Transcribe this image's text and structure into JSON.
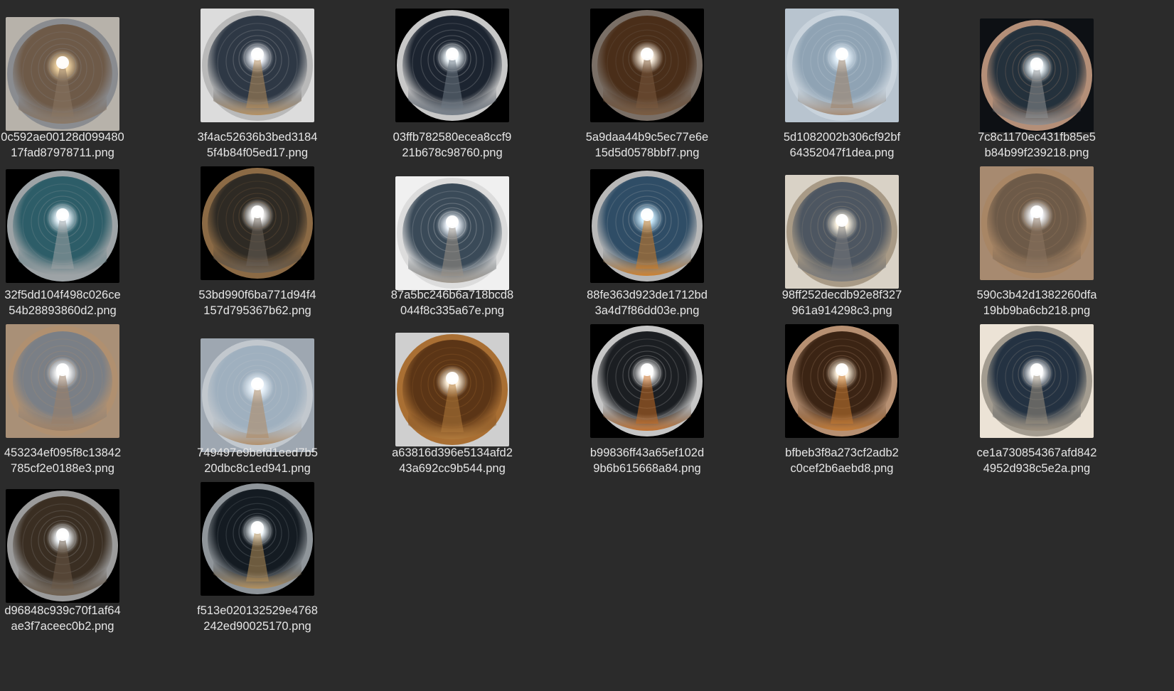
{
  "files": [
    {
      "line1": "0c592ae00128d099480",
      "line2": "17fad87978711.png",
      "rim": "#8a8c90",
      "wall": "#6e5a48",
      "glow": "#f3d6a4",
      "bg": "#b7b2aa",
      "bottom": "#8b7763"
    },
    {
      "line1": "3f4ac52636b3bed3184",
      "line2": "5f4b84f05ed17.png",
      "rim": "#b9b9b9",
      "wall": "#2e3845",
      "glow": "#f6f9ff",
      "bg": "#dcdcdc",
      "bottom": "#b58d5a"
    },
    {
      "line1": "03ffb782580ecea8ccf9",
      "line2": "21b678c98760.png",
      "rim": "#c8c8c8",
      "wall": "#1c2430",
      "glow": "#f3fbff",
      "bg": "#000000",
      "bottom": "#6e7883"
    },
    {
      "line1": "5a9daa44b9c5ec77e6e",
      "line2": "15d5d0578bbf7.png",
      "rim": "#7a6f66",
      "wall": "#4a2e19",
      "glow": "#fff5e6",
      "bg": "#000000",
      "bottom": "#7a5a3e"
    },
    {
      "line1": "5d1082002b306cf92bf",
      "line2": "64352047f1dea.png",
      "rim": "#c9d3dc",
      "wall": "#8fa3b4",
      "glow": "#eaf6ff",
      "bg": "#b8c4cf",
      "bottom": "#a3856a"
    },
    {
      "line1": "7c8c1170ec431fb85e5",
      "line2": "b84b99f239218.png",
      "rim": "#b48f78",
      "wall": "#24313c",
      "glow": "#f3fbff",
      "bg": "#0d1014",
      "bottom": "#8e8f91"
    },
    {
      "line1": "32f5dd104f498c026ce",
      "line2": "54b28893860d2.png",
      "rim": "#9da3a6",
      "wall": "#2d5d68",
      "glow": "#eef8ff",
      "bg": "#000000",
      "bottom": "#a0a4a6"
    },
    {
      "line1": "53bd990f6ba771d94f4",
      "line2": "157d795367b62.png",
      "rim": "#8b6a45",
      "wall": "#2e2a24",
      "glow": "#ffffff",
      "bg": "#000000",
      "bottom": "#6a6157"
    },
    {
      "line1": "87a5bc246b6a718bcd8",
      "line2": "044f8c335a67e.png",
      "rim": "#dcdcdc",
      "wall": "#3a4a58",
      "glow": "#f2f8ff",
      "bg": "#f0f0f0",
      "bottom": "#9a9186"
    },
    {
      "line1": "88fe363d923de1712bd",
      "line2": "3a4d7f86dd03e.png",
      "rim": "#b8b8b8",
      "wall": "#2f4d66",
      "glow": "#cfeeff",
      "bg": "#000000",
      "bottom": "#d07c22"
    },
    {
      "line1": "98ff252decdb92e8f327",
      "line2": "961a914298c3.png",
      "rim": "#a89a86",
      "wall": "#4d5661",
      "glow": "#fff6e3",
      "bg": "#d9d2c6",
      "bottom": "#77797c"
    },
    {
      "line1": "590c3b42d1382260dfa",
      "line2": "19bb9ba6cb218.png",
      "rim": "#a88665",
      "wall": "#6d5a48",
      "glow": "#f8fbff",
      "bg": "#a78a70",
      "bottom": "#8a7460"
    },
    {
      "line1": "453234ef095f8c13842",
      "line2": "785cf2e0188e3.png",
      "rim": "#b09070",
      "wall": "#7a7f86",
      "glow": "#ffffff",
      "bg": "#a99077",
      "bottom": "#9a8068"
    },
    {
      "line1": "749497e9befd1eed7b5",
      "line2": "20dbc8c1ed941.png",
      "rim": "#c2c8ce",
      "wall": "#9fb0bf",
      "glow": "#eef7ff",
      "bg": "#9ea7b1",
      "bottom": "#b08a62"
    },
    {
      "line1": "a63816d396e5134afd2",
      "line2": "43a692cc9b544.png",
      "rim": "#a96f33",
      "wall": "#5b3516",
      "glow": "#fff2dc",
      "bg": "#cfcfcf",
      "bottom": "#b07a3c"
    },
    {
      "line1": "b99836ff43a65ef102d",
      "line2": "9b6b615668a84.png",
      "rim": "#c6c6c6",
      "wall": "#1b1e22",
      "glow": "#ffffff",
      "bg": "#000000",
      "bottom": "#c46b22"
    },
    {
      "line1": "bfbeb3f8a273cf2adb2",
      "line2": "c0cef2b6aebd8.png",
      "rim": "#b79072",
      "wall": "#3b2414",
      "glow": "#fff2dd",
      "bg": "#000000",
      "bottom": "#c67a31"
    },
    {
      "line1": "ce1a730854367afd842",
      "line2": "4952d938c5e2a.png",
      "rim": "#a39c90",
      "wall": "#243242",
      "glow": "#ffffff",
      "bg": "#ece3d6",
      "bottom": "#9a8f7f"
    },
    {
      "line1": "d96848c939c70f1af64",
      "line2": "ae3f7aceec0b2.png",
      "rim": "#9b9b9b",
      "wall": "#3a2e22",
      "glow": "#f6fbff",
      "bg": "#000000",
      "bottom": "#6b5a47"
    },
    {
      "line1": "f513e020132529e4768",
      "line2": "242ed90025170.png",
      "rim": "#8f959a",
      "wall": "#141b22",
      "glow": "#f4fbff",
      "bg": "#000000",
      "bottom": "#b79058"
    }
  ]
}
